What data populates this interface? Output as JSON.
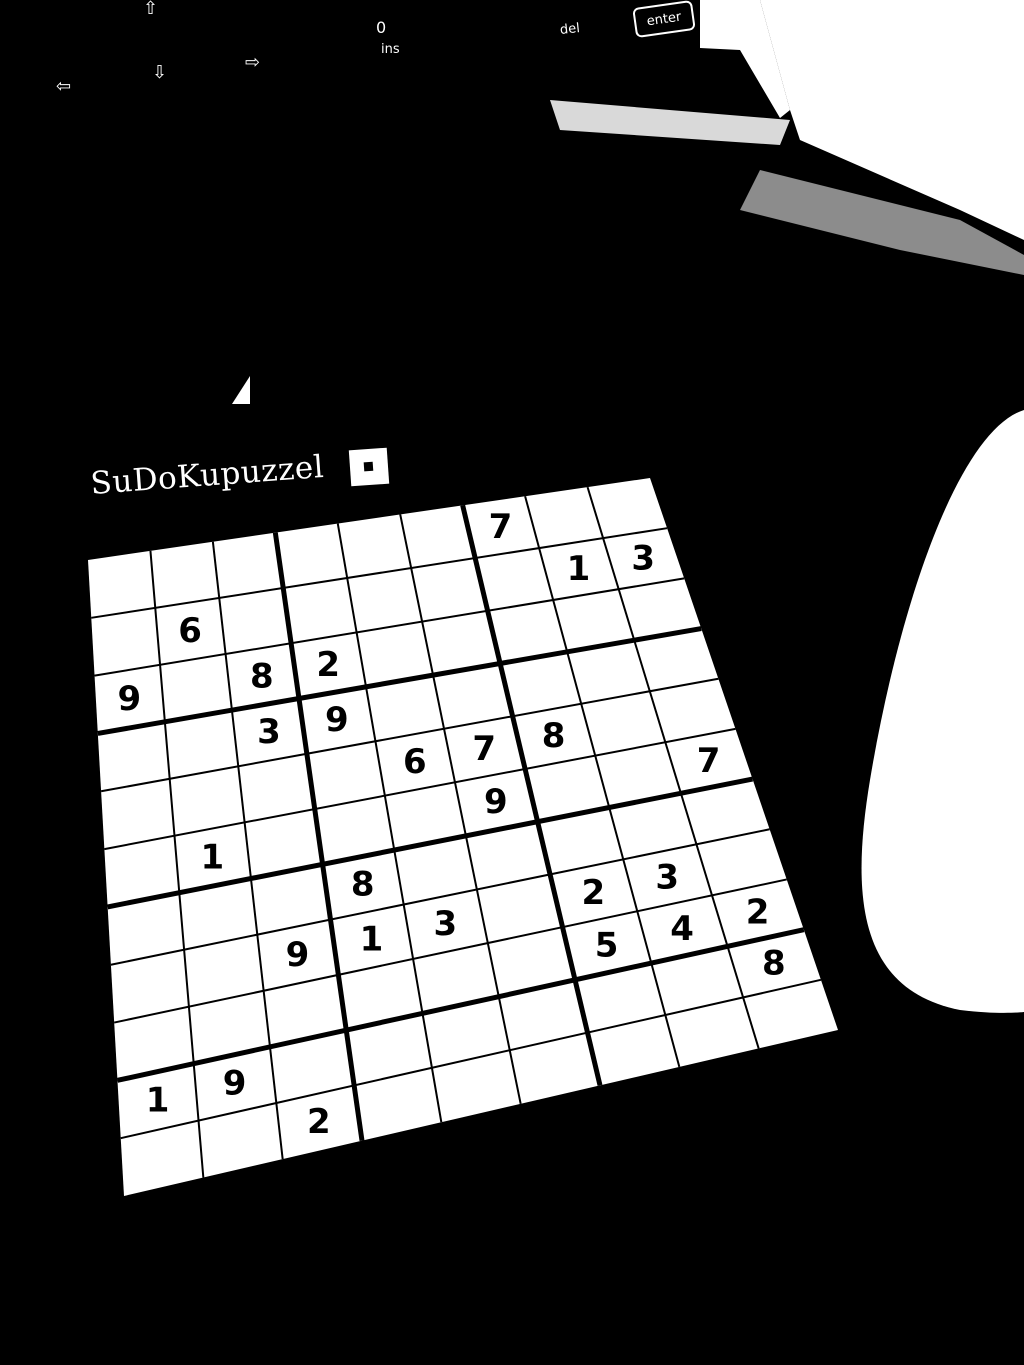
{
  "keyboard": {
    "arrow_up": "⇧",
    "arrow_left": "⇦",
    "arrow_down": "⇩",
    "arrow_right": "⇨",
    "key_zero": "0",
    "key_ins": "ins",
    "key_del": "del",
    "key_enter": "enter"
  },
  "newspaper": {
    "title": "SuDoKupuzzel"
  },
  "sudoku": {
    "rows": [
      [
        "",
        "",
        "",
        "",
        "",
        "",
        "7",
        "",
        ""
      ],
      [
        "",
        "6",
        "",
        "",
        "",
        "",
        "",
        "1",
        "3"
      ],
      [
        "9",
        "",
        "8",
        "2",
        "",
        "",
        "",
        "",
        ""
      ],
      [
        "",
        "",
        "3",
        "9",
        "",
        "",
        "",
        "",
        ""
      ],
      [
        "",
        "",
        "",
        "",
        "6",
        "7",
        "8",
        "",
        ""
      ],
      [
        "",
        "1",
        "",
        "",
        "",
        "9",
        "",
        "",
        "7"
      ],
      [
        "",
        "",
        "",
        "8",
        "",
        "",
        "",
        "",
        ""
      ],
      [
        "",
        "",
        "9",
        "1",
        "3",
        "",
        "2",
        "3",
        ""
      ],
      [
        "",
        "",
        "",
        "",
        "",
        "",
        "5",
        "4",
        "2"
      ],
      [
        "1",
        "9",
        "",
        "",
        "",
        "",
        "",
        "",
        "8"
      ],
      [
        "",
        "",
        "2",
        "",
        "",
        "",
        "",
        "",
        ""
      ]
    ]
  },
  "colors": {
    "background": "#000000",
    "paper": "#ffffff",
    "ink": "#000000"
  }
}
